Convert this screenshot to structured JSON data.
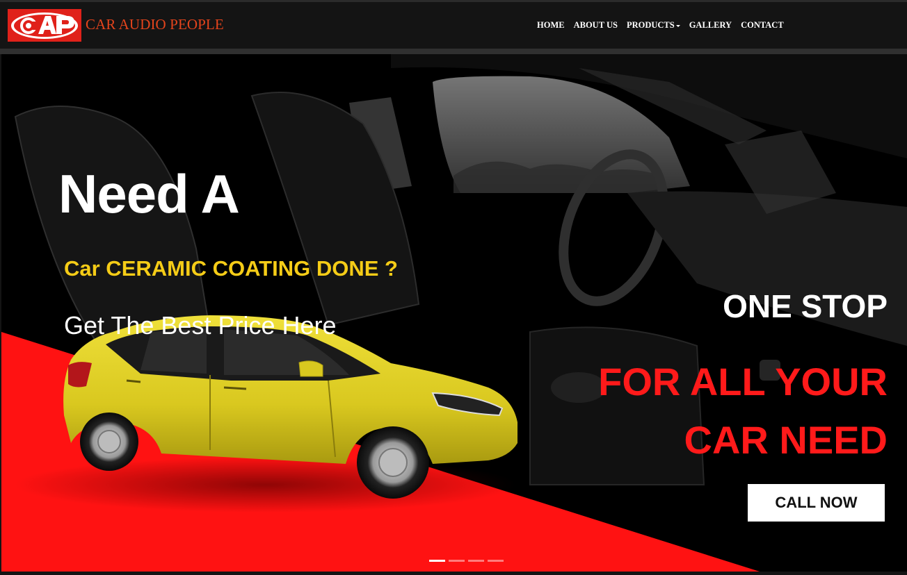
{
  "header": {
    "logo_text": "CAP",
    "brand_name": "CAR AUDIO PEOPLE",
    "nav": [
      {
        "label": "HOME"
      },
      {
        "label": "ABOUT US"
      },
      {
        "label": "PRODUCTS",
        "has_dropdown": true
      },
      {
        "label": "GALLERY"
      },
      {
        "label": "CONTACT"
      }
    ]
  },
  "hero": {
    "headline": "Need A",
    "subheadline": "Car CERAMIC COATING DONE ?",
    "tagline": "Get The Best Price Here",
    "right_line1": "ONE STOP",
    "right_line2": "FOR ALL YOUR",
    "right_line3": "CAR NEED",
    "cta_label": "CALL NOW",
    "slides_total": 4,
    "active_slide": 1
  },
  "colors": {
    "brand_red": "#e0211a",
    "brand_text": "#e4441c",
    "accent_yellow": "#f5cc17",
    "headline_red": "#ff1a1a",
    "nav_bg": "#141414",
    "car_yellow": "#e3d22a"
  }
}
